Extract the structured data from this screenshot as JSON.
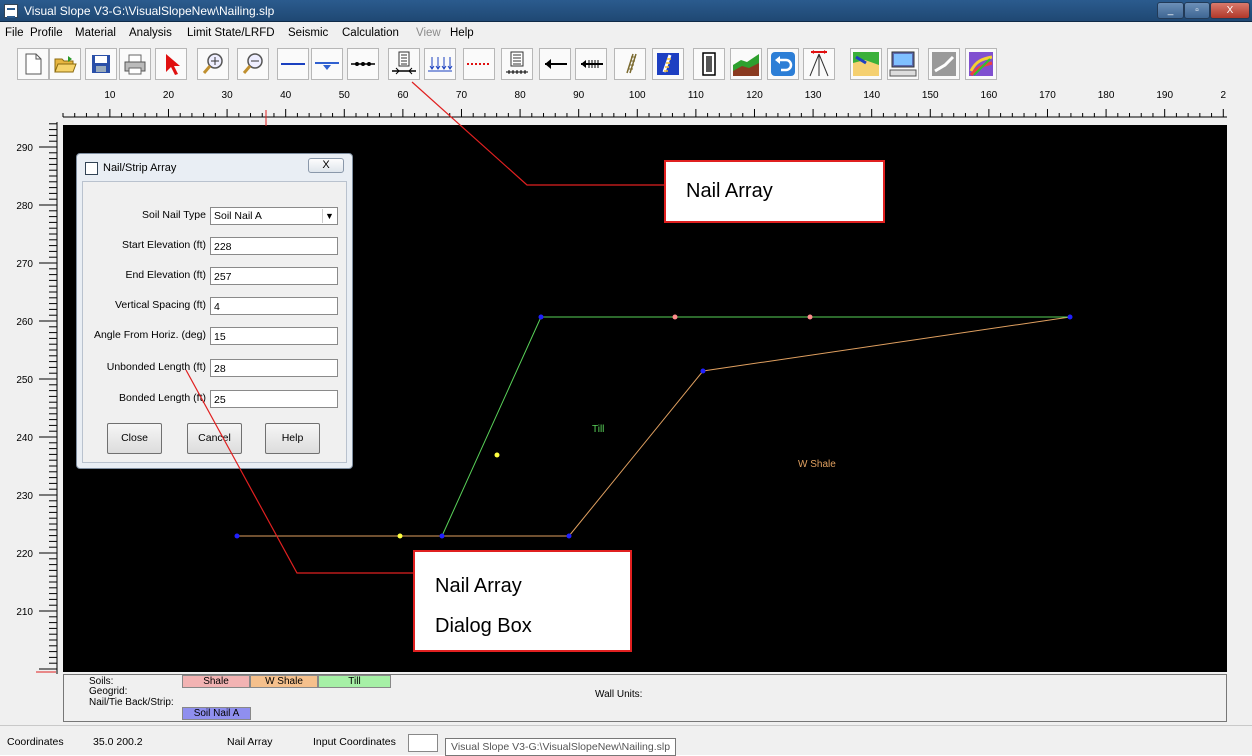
{
  "window": {
    "title": "Visual Slope V3-G:\\VisualSlopeNew\\Nailing.slp",
    "min_glyph": "_",
    "max_glyph": "▫",
    "close_glyph": "X"
  },
  "menu": [
    {
      "label": "File",
      "disabled": false
    },
    {
      "label": "Profile",
      "disabled": false
    },
    {
      "label": "Material",
      "disabled": false
    },
    {
      "label": "Analysis",
      "disabled": false
    },
    {
      "label": "Limit State/LRFD",
      "disabled": false
    },
    {
      "label": "Seismic",
      "disabled": false
    },
    {
      "label": "Calculation",
      "disabled": false
    },
    {
      "label": "View",
      "disabled": true
    },
    {
      "label": "Help",
      "disabled": false
    }
  ],
  "toolbar": [
    "new-file-icon",
    "open-folder-icon",
    "save-disk-icon",
    "print-icon",
    "select-arrow-icon",
    "zoom-in-icon",
    "zoom-out-icon",
    "line-icon",
    "water-table-icon",
    "dotted-line-icon",
    "nail-array-icon",
    "distributed-load-icon",
    "red-dotted-line-icon",
    "strip-icon",
    "arrow-left-icon",
    "tieback-icon",
    "layers-icon",
    "analyze-icon",
    "wall-icon",
    "profile-icon",
    "undo-icon",
    "seismic-icon",
    "cross-section-icon",
    "computer-icon",
    "graph-icon",
    "results-icon"
  ],
  "ruler": {
    "x_ticks": [
      "10",
      "20",
      "30",
      "40",
      "50",
      "60",
      "70",
      "80",
      "90",
      "100",
      "110",
      "120",
      "130",
      "140",
      "150",
      "160",
      "170",
      "180",
      "190",
      "2"
    ],
    "y_ticks": [
      "290",
      "280",
      "270",
      "260",
      "250",
      "240",
      "230",
      "220",
      "210"
    ]
  },
  "canvas": {
    "labels": {
      "till": "Till",
      "w_shale": "W Shale"
    },
    "colors": {
      "till": "#59d259",
      "w_shale": "#e0a060",
      "node": "#2020ff",
      "yellow_node": "#ffff40",
      "pink_node": "#ff8c8c"
    }
  },
  "dialog": {
    "title": "Nail/Strip Array",
    "close_glyph": "X",
    "fields": [
      {
        "label": "Soil Nail Type",
        "value": "Soil Nail A",
        "type": "select"
      },
      {
        "label": "Start Elevation (ft)",
        "value": "228",
        "type": "text"
      },
      {
        "label": "End Elevation (ft)",
        "value": "257",
        "type": "text"
      },
      {
        "label": "Vertical Spacing (ft)",
        "value": "4",
        "type": "text"
      },
      {
        "label": "Angle From Horiz. (deg)",
        "value": "15",
        "type": "text"
      },
      {
        "label": "Unbonded Length (ft)",
        "value": "28",
        "type": "text"
      },
      {
        "label": "Bonded Length (ft)",
        "value": "25",
        "type": "text"
      }
    ],
    "buttons": {
      "close": "Close",
      "cancel": "Cancel",
      "help": "Help"
    }
  },
  "legend": {
    "soils_label": "Soils:",
    "geogrid_label": "Geogrid:",
    "nail_label": "Nail/Tie Back/Strip:",
    "wall_units_label": "Wall Units:",
    "soils": [
      {
        "name": "Shale",
        "color": "#f2b3b3"
      },
      {
        "name": "W Shale",
        "color": "#f5c08c"
      },
      {
        "name": "Till",
        "color": "#a6f0a6"
      }
    ],
    "nail": {
      "name": "Soil Nail A",
      "color": "#8f8fef"
    }
  },
  "status": {
    "coordinates_label": "Coordinates",
    "coordinates_value": "35.0  200.2",
    "mode": "Nail Array",
    "input_label": "Input Coordinates",
    "tooltip": "Visual Slope V3-G:\\VisualSlopeNew\\Nailing.slp"
  },
  "callouts": {
    "nail_array": "Nail  Array",
    "dialog_line1": "Nail Array",
    "dialog_line2": "Dialog Box"
  }
}
